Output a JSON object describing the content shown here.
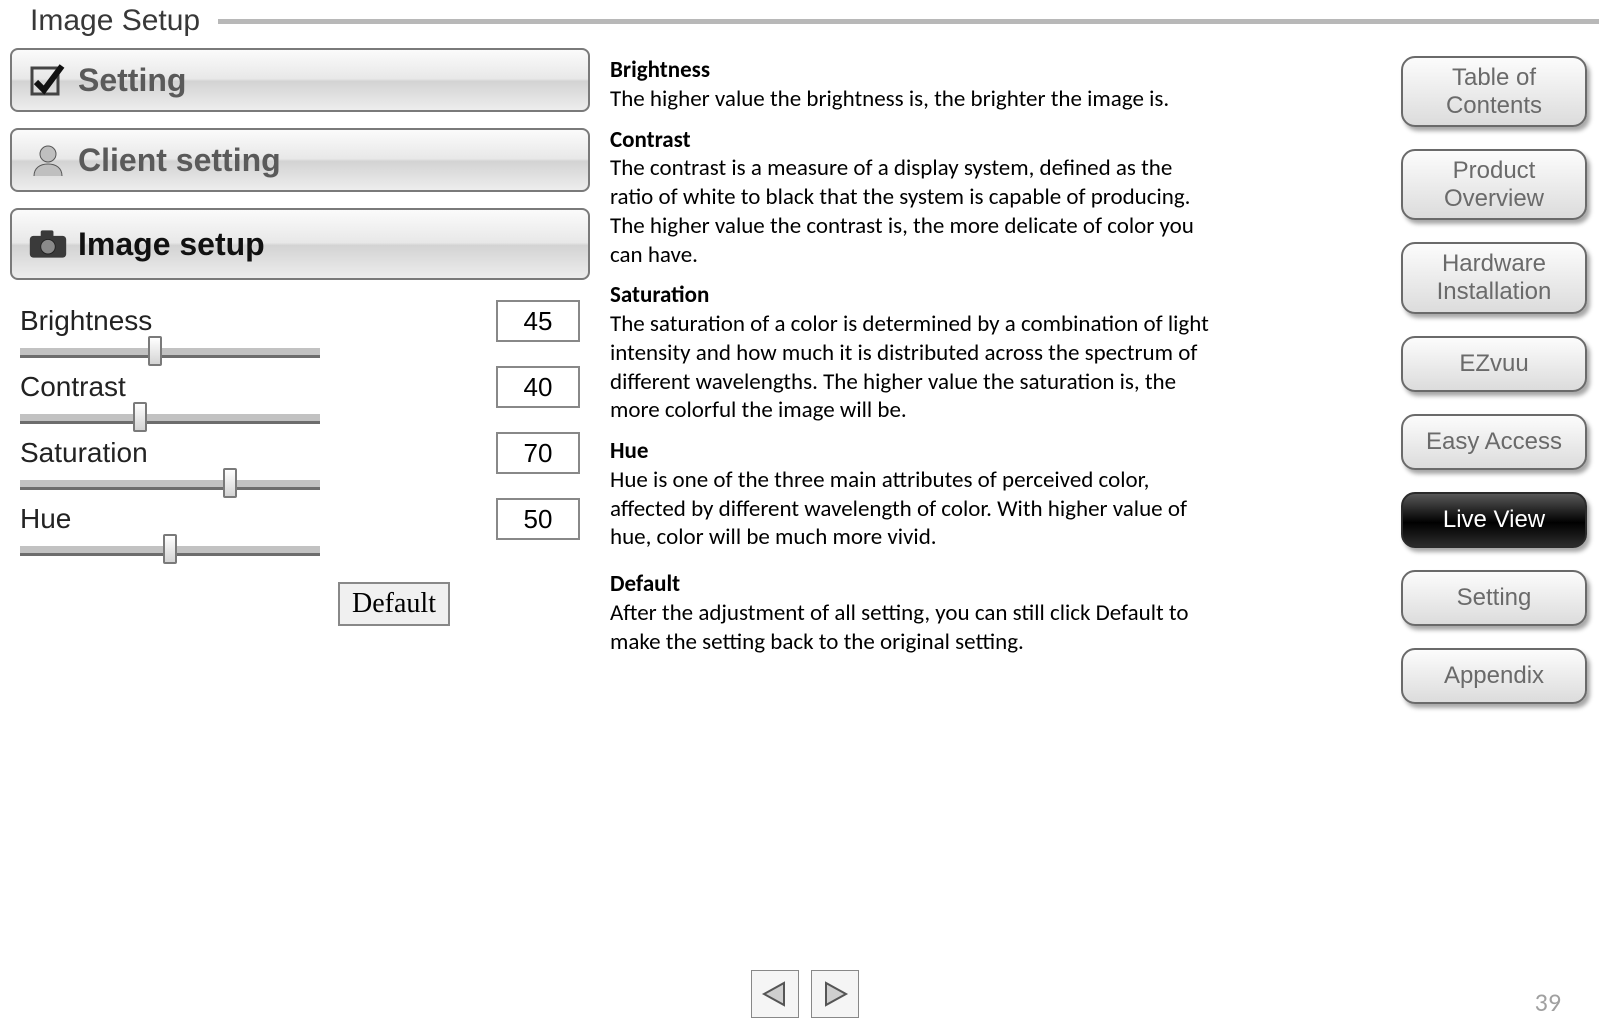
{
  "page_title": "Image Setup",
  "page_number": "39",
  "left_panel": {
    "tabs": [
      {
        "label": "Setting",
        "icon": "check-icon"
      },
      {
        "label": "Client setting",
        "icon": "person-icon"
      },
      {
        "label": "Image setup",
        "icon": "camera-icon"
      }
    ],
    "sliders": [
      {
        "label": "Brightness",
        "value": "45",
        "pos_pct": 45
      },
      {
        "label": "Contrast",
        "value": "40",
        "pos_pct": 40
      },
      {
        "label": "Saturation",
        "value": "70",
        "pos_pct": 70
      },
      {
        "label": "Hue",
        "value": "50",
        "pos_pct": 50
      }
    ],
    "default_label": "Default"
  },
  "descriptions": [
    {
      "title": "Brightness",
      "body": "The higher value the brightness is, the brighter the image is."
    },
    {
      "title": "Contrast",
      "body": "The contrast is a measure of a display system, defined as the ratio of white to black that the system is capable of producing. The higher value the contrast is, the more delicate of color you can have."
    },
    {
      "title": "Saturation",
      "body": "The saturation of a color is determined by a combination of light intensity and how much it is distributed across the spectrum of different wavelengths. The higher value the saturation is, the more colorful the image will be."
    },
    {
      "title": "Hue",
      "body": "Hue is one of the three main attributes of perceived color, affected by different wavelength of color. With higher value of hue, color will be much more vivid."
    },
    {
      "title": "Default",
      "body": "After the adjustment of all setting, you can still click Default to make the setting back to the original setting."
    }
  ],
  "nav": [
    {
      "label": "Table of\nContents",
      "active": false
    },
    {
      "label": "Product\nOverview",
      "active": false
    },
    {
      "label": "Hardware\nInstallation",
      "active": false
    },
    {
      "label": "EZvuu",
      "active": false
    },
    {
      "label": "Easy Access",
      "active": false
    },
    {
      "label": "Live View",
      "active": true
    },
    {
      "label": "Setting",
      "active": false
    },
    {
      "label": "Appendix",
      "active": false
    }
  ]
}
